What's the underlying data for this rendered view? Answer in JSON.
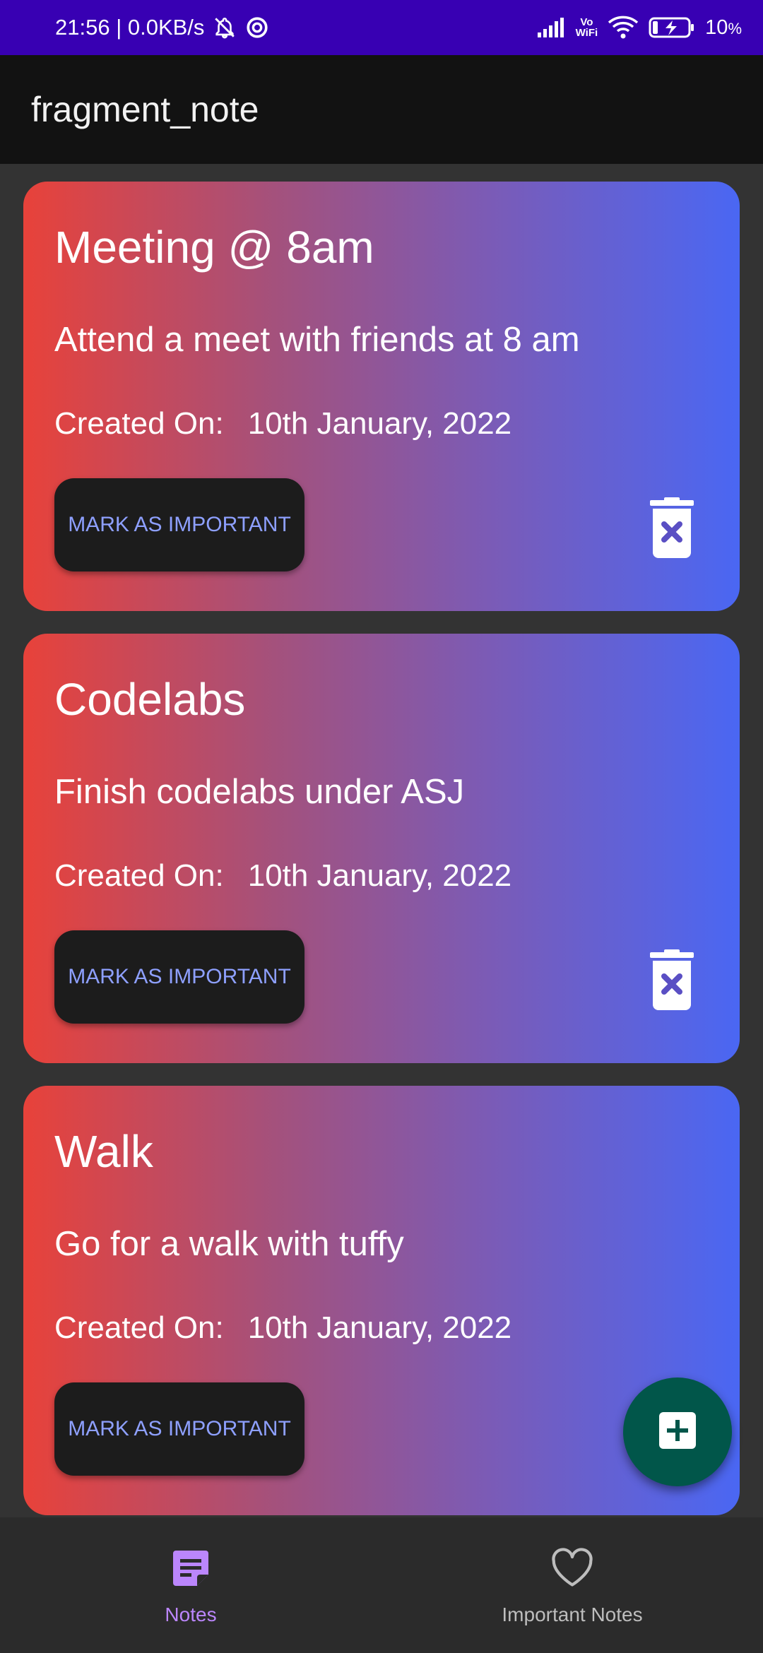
{
  "status_bar": {
    "time_and_speed": "21:56 | 0.0KB/s",
    "vowifi_top": "Vo",
    "vowifi_bottom": "WiFi",
    "battery": "10",
    "battery_unit": "%"
  },
  "app_bar": {
    "title": "fragment_note"
  },
  "notes": [
    {
      "title": "Meeting @ 8am",
      "description": "Attend a meet with friends at 8 am",
      "created_label": "Created On:",
      "created_date": "10th January, 2022",
      "button_label": "MARK AS IMPORTANT"
    },
    {
      "title": "Codelabs",
      "description": "Finish codelabs under ASJ",
      "created_label": "Created On:",
      "created_date": "10th January, 2022",
      "button_label": "MARK AS IMPORTANT"
    },
    {
      "title": "Walk",
      "description": "Go for a walk with tuffy",
      "created_label": "Created On:",
      "created_date": "10th January, 2022",
      "button_label": "MARK AS IMPORTANT"
    }
  ],
  "fab": {
    "icon": "add-icon"
  },
  "bottom_nav": {
    "items": [
      {
        "label": "Notes",
        "icon": "notes-icon",
        "active": true
      },
      {
        "label": "Important Notes",
        "icon": "heart-icon",
        "active": false
      }
    ]
  },
  "colors": {
    "status_bar": "#3800b3",
    "app_bar": "#121212",
    "card_gradient_start": "#e8423a",
    "card_gradient_end": "#4a67f3",
    "button_text": "#8ea0ff",
    "fab": "#01564a",
    "nav_active": "#bb86fc"
  }
}
